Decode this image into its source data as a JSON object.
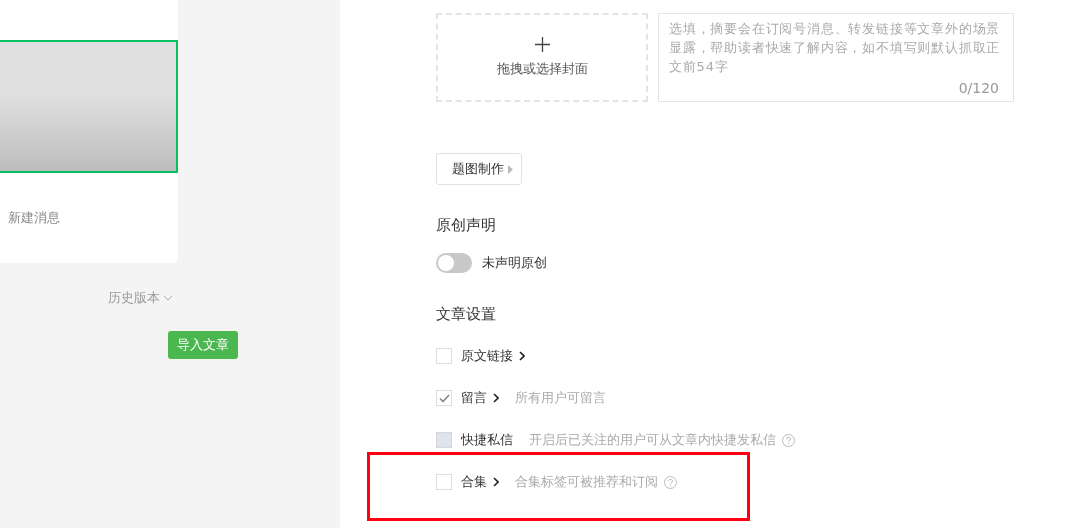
{
  "preview": {
    "message_title": "新建消息",
    "history_link": "历史版本",
    "import_button": "导入文章"
  },
  "cover": {
    "label": "拖拽或选择封面"
  },
  "summary": {
    "placeholder": "选填，摘要会在订阅号消息、转发链接等文章外的场景显露，帮助读者快速了解内容，如不填写则默认抓取正文前54字",
    "counter": "0/120"
  },
  "cover_maker_button": "题图制作",
  "original": {
    "heading": "原创声明",
    "switch_label": "未声明原创",
    "on": false
  },
  "settings": {
    "heading": "文章设置",
    "items": [
      {
        "label": "原文链接",
        "checked": false,
        "disabled": false,
        "chevron": true
      },
      {
        "label": "留言",
        "checked": true,
        "disabled": false,
        "chevron": true,
        "description": "所有用户可留言"
      },
      {
        "label": "快捷私信",
        "checked": false,
        "disabled": true,
        "chevron": false,
        "description": "开启后已关注的用户可从文章内快捷发私信",
        "help": true
      },
      {
        "label": "合集",
        "checked": false,
        "disabled": false,
        "chevron": true,
        "description": "合集标签可被推荐和订阅",
        "help": true,
        "highlighted": true
      }
    ]
  }
}
